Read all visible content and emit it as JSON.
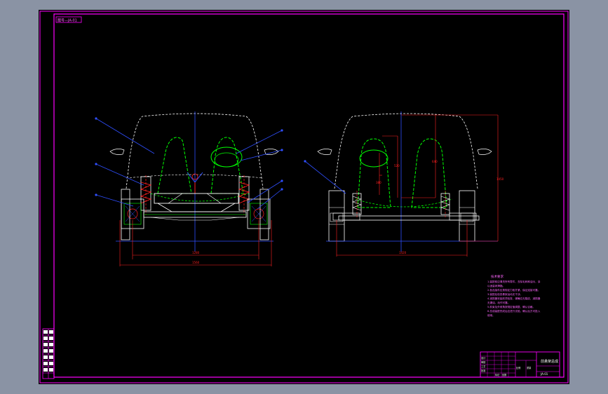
{
  "drawing": {
    "sheet_tag": "图号—JA-01",
    "notes_title": "技术要求",
    "notes_lines": [
      "1.装配前应清洗所有零件，去除毛刺和油污，涂",
      "以适量润滑脂。",
      "2.各连接件应按规定力矩拧紧，保证连接可靠。",
      "3.装配后检查悬架运动无干涉。",
      "4.减振器安装前须检查，弹簧应无裂纹，减振器",
      "无漏油，动作可靠。",
      "5.前束及外倾角按规定值调整，确认合格。",
      "6.总成装配完成后应进行试验，确认后方可投入",
      "使用。"
    ],
    "title_block": {
      "name": "前悬架总成",
      "code": "JA-01",
      "grid_labels": [
        "设计",
        "审核",
        "工艺",
        "批准",
        "标记",
        "处数",
        "比例",
        "重量"
      ]
    },
    "dimensions": {
      "front_track_inner": "1280",
      "front_track_outer": "1560",
      "rear_track": "1420",
      "overall_height": "1450",
      "h1": "380",
      "h2": "520",
      "h3": "640"
    },
    "colors": {
      "background": "#000000",
      "frame": "#ff00ff",
      "outline": "#ffffff",
      "green": "#00ff00",
      "red": "#ff2020",
      "blue": "#2f4fff",
      "yellow": "#ffff00"
    }
  }
}
